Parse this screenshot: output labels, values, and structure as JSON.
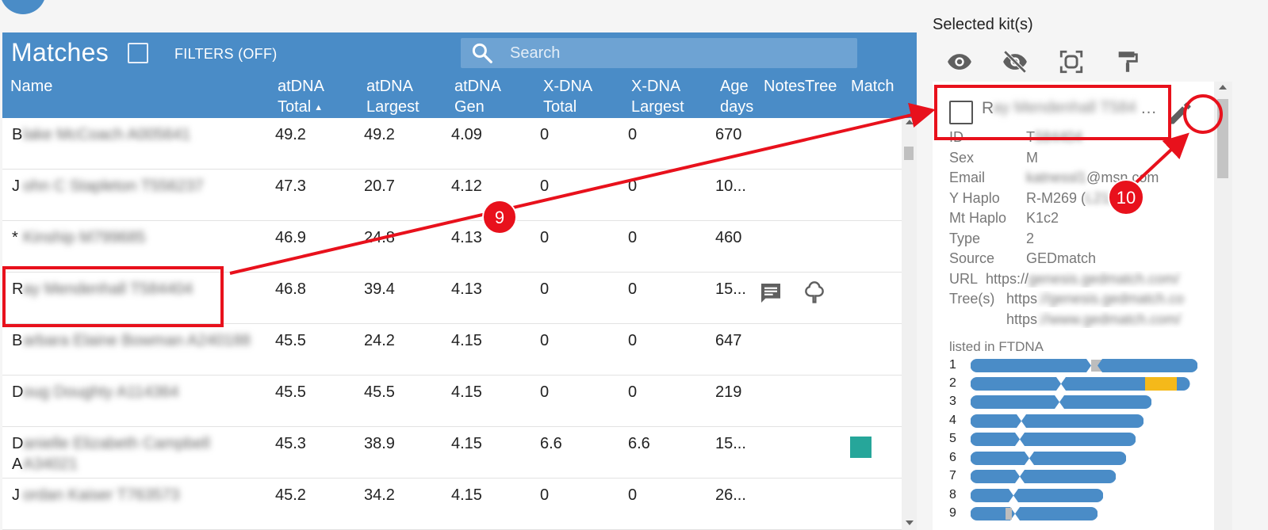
{
  "matches": {
    "title": "Matches",
    "filters_label": "FILTERS (OFF)",
    "search_placeholder": "Search",
    "columns": [
      {
        "line1": "Name",
        "line2": ""
      },
      {
        "line1": "atDNA",
        "line2": "Total"
      },
      {
        "line1": "atDNA",
        "line2": "Largest"
      },
      {
        "line1": "atDNA",
        "line2": "Gen"
      },
      {
        "line1": "X-DNA",
        "line2": "Total"
      },
      {
        "line1": "X-DNA",
        "line2": "Largest"
      },
      {
        "line1": "Age",
        "line2": "days"
      },
      {
        "line1": "Notes",
        "line2": ""
      },
      {
        "line1": "Tree",
        "line2": ""
      },
      {
        "line1": "Match",
        "line2": ""
      }
    ],
    "sort_indicator": "▲",
    "rows": [
      {
        "initial": "B",
        "hidden": "lake McCoach A005641",
        "hidden2": "",
        "total": "49.2",
        "largest": "49.2",
        "gen": "4.09",
        "xtotal": "0",
        "xlargest": "0",
        "age": "670"
      },
      {
        "initial": "J",
        "hidden": "ohn C Stapleton T556237",
        "hidden2": "",
        "total": "47.3",
        "largest": "20.7",
        "gen": "4.12",
        "xtotal": "0",
        "xlargest": "0",
        "age": "10..."
      },
      {
        "initial": "*",
        "hidden": "Kinship M799685",
        "hidden2": "",
        "total": "46.9",
        "largest": "24.8",
        "gen": "4.13",
        "xtotal": "0",
        "xlargest": "0",
        "age": "460"
      },
      {
        "initial": "R",
        "hidden": "ay Mendenhall T584404",
        "hidden2": "",
        "total": "46.8",
        "largest": "39.4",
        "gen": "4.13",
        "xtotal": "0",
        "xlargest": "0",
        "age": "15..."
      },
      {
        "initial": "B",
        "hidden": "arbara Elaine Bowman A240188",
        "hidden2": "",
        "total": "45.5",
        "largest": "24.2",
        "gen": "4.15",
        "xtotal": "0",
        "xlargest": "0",
        "age": "647"
      },
      {
        "initial": "D",
        "hidden": "oug Doughty A114364",
        "hidden2": "",
        "total": "45.5",
        "largest": "45.5",
        "gen": "4.15",
        "xtotal": "0",
        "xlargest": "0",
        "age": "219"
      },
      {
        "initial": "D",
        "hidden": "anielle Elizabeth Campbell",
        "hidden2": "A",
        "hidden3": "A34021",
        "total": "45.3",
        "largest": "38.9",
        "gen": "4.15",
        "xtotal": "6.6",
        "xlargest": "6.6",
        "age": "15..."
      },
      {
        "initial": "J",
        "hidden": "ordan Kaiser T763573",
        "hidden2": "",
        "total": "45.2",
        "largest": "34.2",
        "gen": "4.15",
        "xtotal": "0",
        "xlargest": "0",
        "age": "26..."
      }
    ],
    "match_color": "#26a69a"
  },
  "kit": {
    "panel_title": "Selected kit(s)",
    "tools": [
      "eye-icon",
      "eye-off-icon",
      "select-all-icon",
      "paint-roller-icon"
    ],
    "name_initial": "R",
    "name_hidden": "ay Mendenhall T584",
    "name_ellipsis": "…",
    "fields": [
      {
        "label": "ID",
        "value_visible": "T",
        "value_hidden": "584404"
      },
      {
        "label": "Sex",
        "value_visible": "M",
        "value_hidden": ""
      },
      {
        "label": "Email",
        "value_visible": "@msn.com",
        "value_hidden": "katnessl1"
      },
      {
        "label": "Y Haplo",
        "value_visible": "R-M269 (",
        "value_hidden": "L21a",
        "value_tail": "a2)"
      },
      {
        "label": "Mt Haplo",
        "value_visible": "K1c2",
        "value_hidden": ""
      },
      {
        "label": "Type",
        "value_visible": "2",
        "value_hidden": ""
      },
      {
        "label": "Source",
        "value_visible": "GEDmatch",
        "value_hidden": ""
      },
      {
        "label": "URL",
        "value_visible": "https://",
        "value_hidden": "genesis.gedmatch.com/"
      },
      {
        "label": "Tree(s)",
        "value_visible": "https",
        "value_hidden": "://genesis.gedmatch.co"
      },
      {
        "label": "",
        "value_visible": "https",
        "value_hidden": "://www.gedmatch.com/"
      }
    ],
    "listed_in": "listed in FTDNA",
    "chromosomes": [
      "1",
      "2",
      "3",
      "4",
      "5",
      "6",
      "7",
      "8",
      "9"
    ],
    "chromosome_color": "#4a8cc7",
    "segment_color": "#f5b91a"
  },
  "annotations": [
    {
      "label": "9",
      "color": "#e8111c"
    },
    {
      "label": "10",
      "color": "#e8111c"
    }
  ],
  "colors": {
    "header_blue": "#4a8cc7",
    "annotation_red": "#e8111c"
  }
}
